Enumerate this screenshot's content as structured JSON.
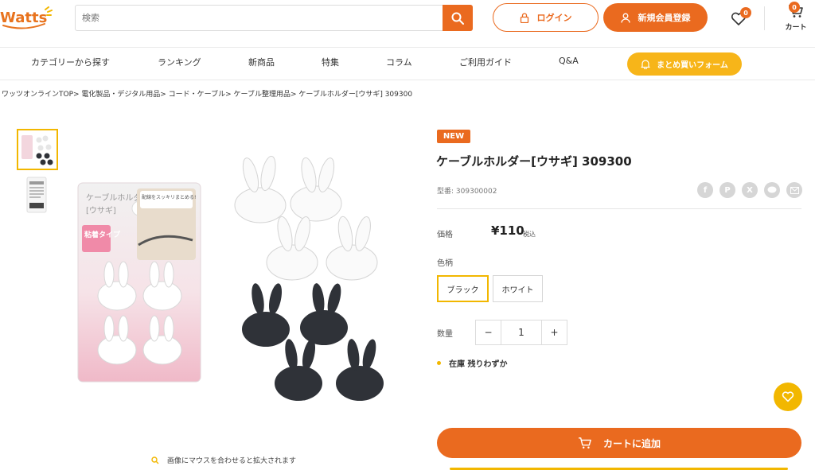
{
  "header": {
    "logo_text": "Watts",
    "search_placeholder": "検索",
    "login_label": "ログイン",
    "register_label": "新規会員登録",
    "favorites_count": "0",
    "cart_count": "0",
    "cart_label": "カート"
  },
  "nav": {
    "items": [
      "カテゴリーから探す",
      "ランキング",
      "新商品",
      "特集",
      "コラム",
      "ご利用ガイド",
      "Q&A"
    ],
    "bulk_order_label": "まとめ買いフォーム"
  },
  "breadcrumb": "ワッツオンラインTOP> 電化製品・デジタル用品> コード・ケーブル> ケーブル整理用品> ケーブルホルダー[ウサギ] 309300",
  "gallery": {
    "package_title": "ケーブルホルダー",
    "package_subtitle": "[ウサギ]",
    "package_tag": "粘着タイプ",
    "package_bubble": "配線をスッキリまとめる!",
    "zoom_hint": "画像にマウスを合わせると拡大されます"
  },
  "product": {
    "badge": "NEW",
    "title": "ケーブルホルダー[ウサギ] 309300",
    "model_label": "型番:",
    "model_number": "309300002",
    "price_label": "価格",
    "price": "¥110",
    "tax_note": "税込",
    "color_label": "色柄",
    "colors": [
      "ブラック",
      "ホワイト"
    ],
    "selected_color": "ブラック",
    "quantity_label": "数量",
    "quantity": "1",
    "quantity_minus": "−",
    "quantity_plus": "+",
    "stock_label": "在庫",
    "stock_status": "残りわずか",
    "add_to_cart_label": "カートに追加"
  },
  "share_icons": [
    "facebook-icon",
    "pinterest-icon",
    "x-icon",
    "line-icon",
    "mail-icon"
  ],
  "colors": {
    "accent_orange": "#ea6a1f",
    "accent_yellow": "#f2b700"
  }
}
